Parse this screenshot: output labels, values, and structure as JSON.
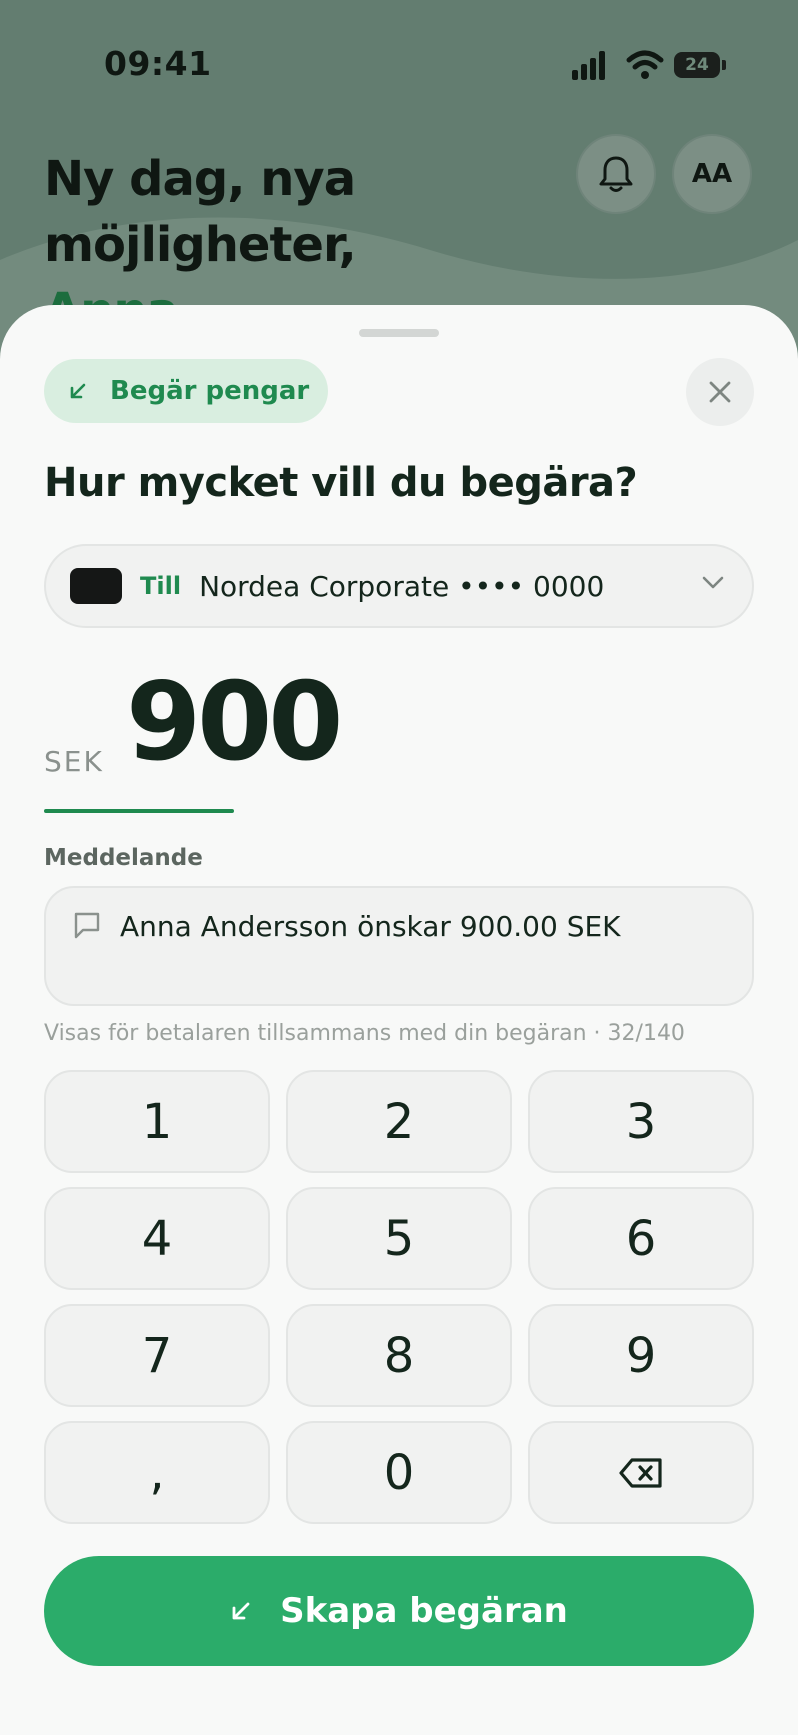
{
  "status_bar": {
    "time": "09:41",
    "battery": "24"
  },
  "background": {
    "greeting_line1": "Ny dag, nya",
    "greeting_line2": "möjligheter,",
    "greeting_name": "Anna",
    "avatar_initials": "AA"
  },
  "sheet": {
    "type_label": "Begär pengar",
    "heading": "Hur mycket vill du begära?",
    "account": {
      "prefix": "Till",
      "name": "Nordea Corporate •••• 0000"
    },
    "amount": {
      "currency": "SEK",
      "value": "900"
    },
    "message": {
      "label": "Meddelande",
      "value": "Anna Andersson önskar 900.00 SEK",
      "hint": "Visas för betalaren tillsammans med din begäran · 32/140"
    },
    "keypad": [
      "1",
      "2",
      "3",
      "4",
      "5",
      "6",
      "7",
      "8",
      "9",
      ",",
      "0"
    ],
    "submit_label": "Skapa begäran"
  },
  "colors": {
    "accent": "#2bac6a",
    "accent_dark": "#1f8a4f",
    "pill_bg": "#d9eee0"
  },
  "icons": [
    "signal-icon",
    "wifi-icon",
    "battery-icon",
    "bell-icon",
    "arrow-down-left-icon",
    "close-icon",
    "chevron-down-icon",
    "message-icon",
    "backspace-icon"
  ]
}
